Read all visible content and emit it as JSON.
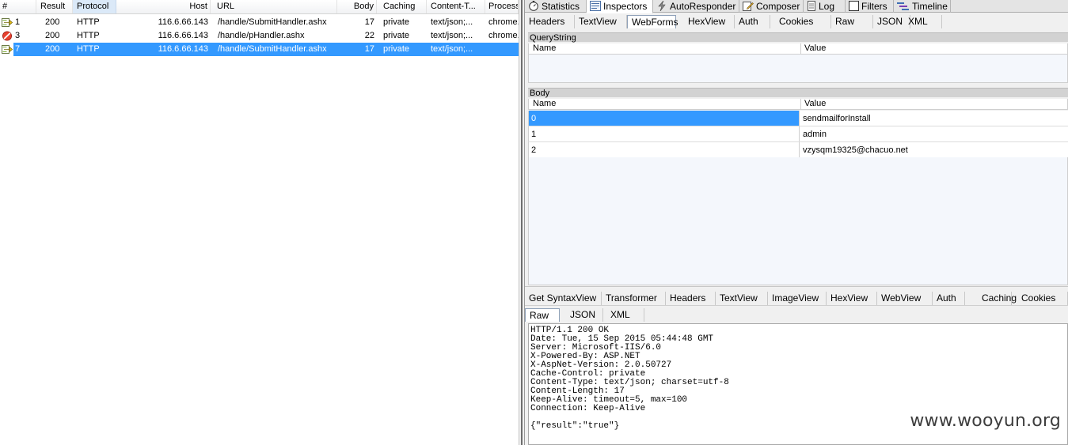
{
  "sessions": {
    "columns": [
      "#",
      "Result",
      "Protocol",
      "Host",
      "URL",
      "Body",
      "Caching",
      "Content-T...",
      "Process"
    ],
    "rows": [
      {
        "icon": "request-arrow-icon",
        "num": "1",
        "result": "200",
        "protocol": "HTTP",
        "host": "116.6.66.143",
        "url": "/handle/SubmitHandler.ashx",
        "body": "17",
        "caching": "private",
        "content_type": "text/json;...",
        "process": "chrome..."
      },
      {
        "icon": "blocked-icon",
        "num": "3",
        "result": "200",
        "protocol": "HTTP",
        "host": "116.6.66.143",
        "url": "/handle/pHandler.ashx",
        "body": "22",
        "caching": "private",
        "content_type": "text/json;...",
        "process": "chrome..."
      },
      {
        "icon": "request-arrow-icon",
        "num": "7",
        "result": "200",
        "protocol": "HTTP",
        "host": "116.6.66.143",
        "url": "/handle/SubmitHandler.ashx",
        "body": "17",
        "caching": "private",
        "content_type": "text/json;...",
        "process": ""
      }
    ]
  },
  "top_tabs": [
    {
      "label": "Statistics",
      "icon": "stopwatch-icon"
    },
    {
      "label": "Inspectors",
      "icon": "inspectors-icon"
    },
    {
      "label": "AutoResponder",
      "icon": "lightning-icon"
    },
    {
      "label": "Composer",
      "icon": "composer-icon"
    },
    {
      "label": "Log",
      "icon": "log-icon"
    },
    {
      "label": "Filters",
      "icon": "checkbox-icon"
    },
    {
      "label": "Timeline",
      "icon": "timeline-icon"
    }
  ],
  "request_tabs": [
    "Headers",
    "TextView",
    "WebForms",
    "HexView",
    "Auth",
    "Cookies",
    "Raw",
    "JSON",
    "XML"
  ],
  "querystring": {
    "title": "QueryString",
    "col_name": "Name",
    "col_value": "Value"
  },
  "body": {
    "title": "Body",
    "col_name": "Name",
    "col_value": "Value",
    "rows": [
      {
        "name": "0",
        "value": "sendmailforInstall"
      },
      {
        "name": "1",
        "value": "admin"
      },
      {
        "name": "2",
        "value": "vzysqm19325@chacuo.net"
      }
    ]
  },
  "response_tabs_row1": [
    "Get SyntaxView",
    "Transformer",
    "Headers",
    "TextView",
    "ImageView",
    "HexView",
    "WebView",
    "Auth",
    "Caching",
    "Cookies"
  ],
  "response_tabs_row2": [
    "Raw",
    "JSON",
    "XML"
  ],
  "raw_response": [
    "HTTP/1.1 200 OK",
    "Date: Tue, 15 Sep 2015 05:44:48 GMT",
    "Server: Microsoft-IIS/6.0",
    "X-Powered-By: ASP.NET",
    "X-AspNet-Version: 2.0.50727",
    "Cache-Control: private",
    "Content-Type: text/json; charset=utf-8",
    "Content-Length: 17",
    "Keep-Alive: timeout=5, max=100",
    "Connection: Keep-Alive",
    "",
    "{\"result\":\"true\"}"
  ],
  "watermark": "www.wooyun.org",
  "colors": {
    "selection": "#3399ff",
    "tab_border": "#8fa1b8",
    "panel_bg": "#f0f0f0"
  }
}
